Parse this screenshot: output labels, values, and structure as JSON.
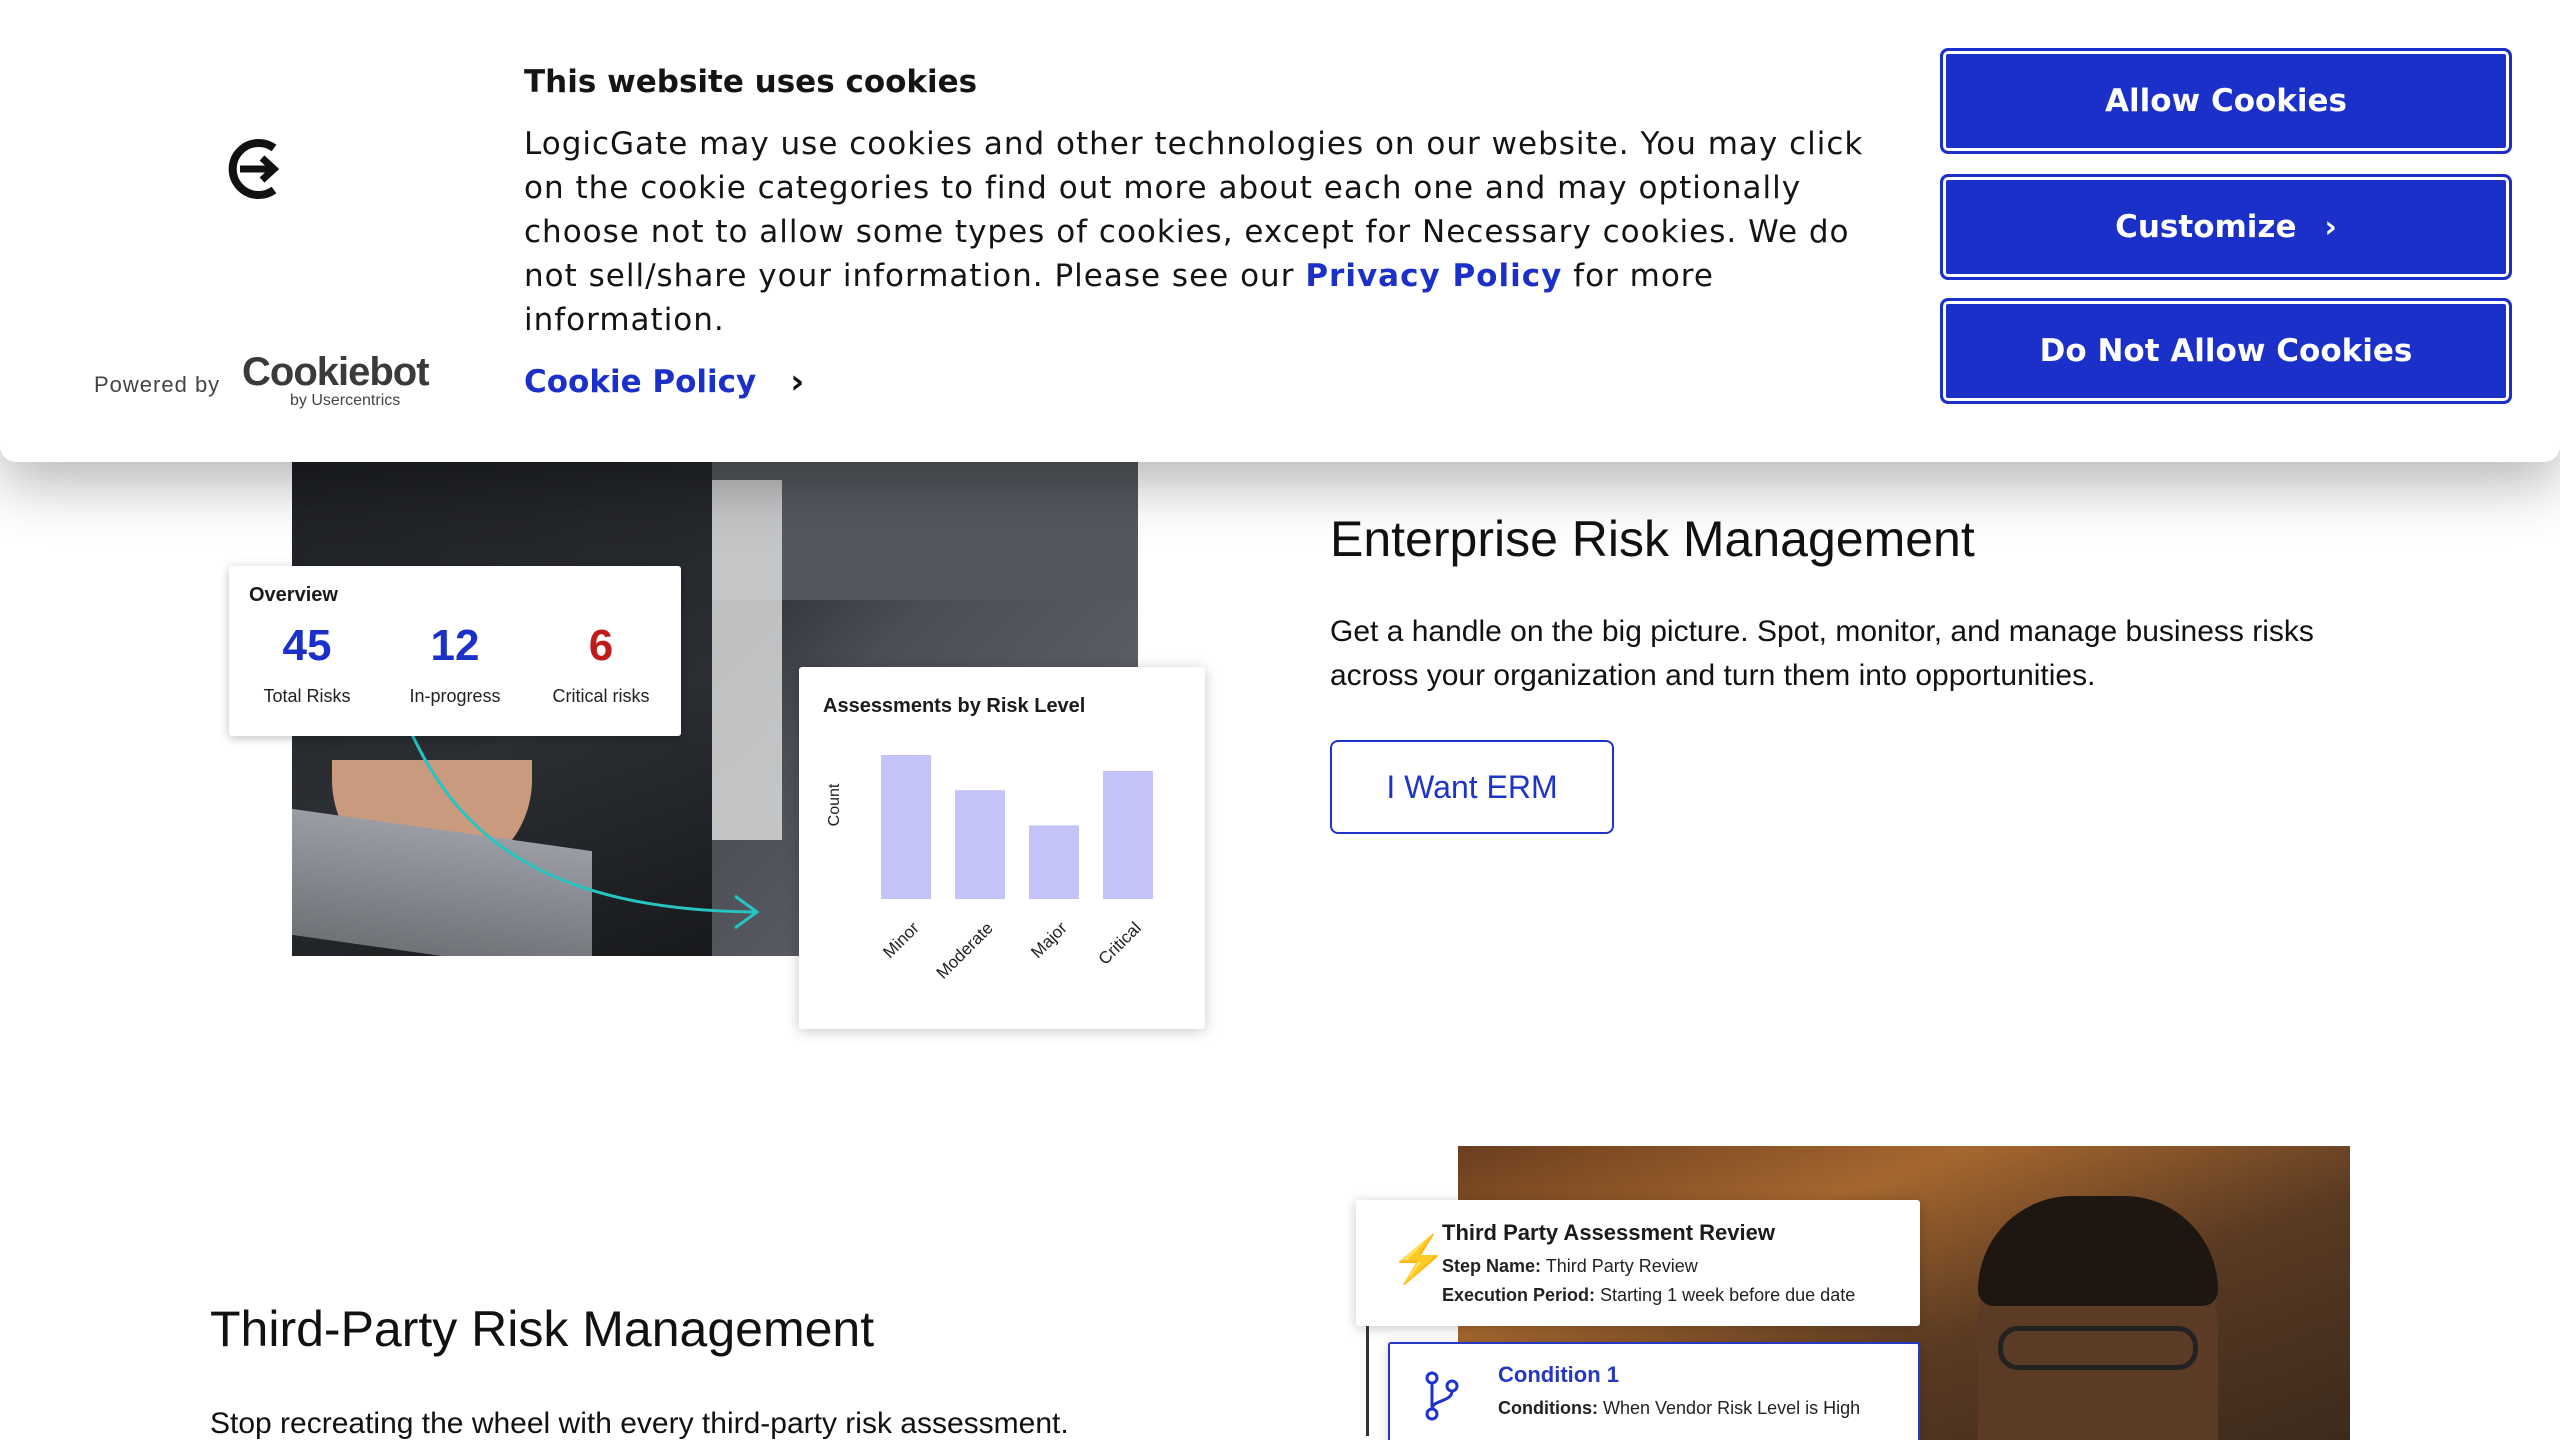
{
  "cookie_banner": {
    "title": "This website uses cookies",
    "body_before_link": "LogicGate may use cookies and other technologies on our website. You may click on the cookie categories to find out more about each one and may optionally choose not to allow some types of cookies, except for Necessary cookies.  We do not sell/share your information. Please see our ",
    "privacy_link": "Privacy Policy",
    "body_after_link": " for more information.",
    "cookie_policy_link": "Cookie Policy",
    "powered_by": "Powered by",
    "cookiebot_brand": "Cookiebot",
    "cookiebot_sub": "by Usercentrics",
    "buttons": {
      "allow": "Allow Cookies",
      "customize": "Customize",
      "deny": "Do Not Allow Cookies"
    },
    "accent_color": "#1b30c8"
  },
  "erm": {
    "heading": "Enterprise Risk Management",
    "text": "Get a handle on the big picture. Spot, monitor, and manage business risks across your organization and turn them into opportunities.",
    "button": "I Want ERM",
    "overview": {
      "title": "Overview",
      "stats": [
        {
          "value": "45",
          "label": "Total Risks",
          "color": "#1b30c8"
        },
        {
          "value": "12",
          "label": "In-progress",
          "color": "#1b30c8"
        },
        {
          "value": "6",
          "label": "Critical risks",
          "color": "#c01a1a"
        }
      ]
    }
  },
  "chart_data": {
    "type": "bar",
    "title": "Assessments by Risk Level",
    "ylabel": "Count",
    "xlabel": "",
    "categories": [
      "Minor",
      "Moderate",
      "Major",
      "Critical"
    ],
    "values": [
      9,
      6.8,
      4.6,
      8
    ],
    "ylim": [
      0,
      10
    ],
    "bar_color": "#c3c3f7",
    "grid": false
  },
  "tprm": {
    "heading": "Third-Party Risk Management",
    "text": "Stop recreating the wheel with every third-party risk assessment.",
    "card": {
      "title": "Third Party Assessment Review",
      "step_label": "Step Name:",
      "step_value": "Third Party Review",
      "period_label": "Execution Period:",
      "period_value": "Starting 1 week before due date"
    },
    "condition": {
      "title": "Condition 1",
      "label": "Conditions:",
      "value": "When Vendor Risk Level is High"
    }
  }
}
